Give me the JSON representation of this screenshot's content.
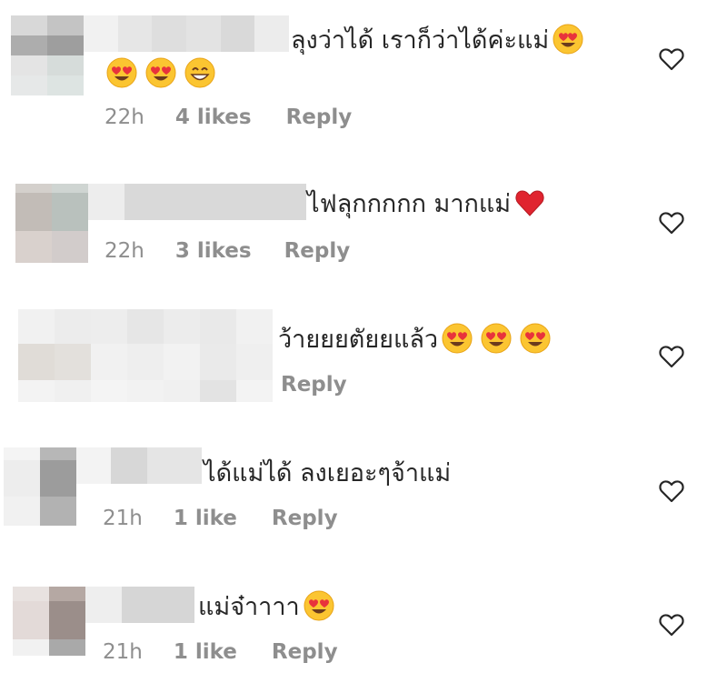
{
  "comments": [
    {
      "text": "ลุงว่าได้ เราก็ว่าได้ค่ะแม่",
      "emojis_inline": [
        "heart-eyes"
      ],
      "emojis_next_line": [
        "heart-eyes",
        "heart-eyes",
        "grinning"
      ],
      "time": "22h",
      "likes": "4 likes",
      "reply": "Reply"
    },
    {
      "text": "ไฟลุกกกกก มากแม่",
      "emojis_inline": [
        "red-heart"
      ],
      "emojis_next_line": [],
      "time": "22h",
      "likes": "3 likes",
      "reply": "Reply"
    },
    {
      "text": "ว้ายยยตัยยแล้ว",
      "emojis_inline": [
        "heart-eyes",
        "heart-eyes",
        "heart-eyes"
      ],
      "emojis_next_line": [],
      "time": "",
      "likes": "",
      "reply": "Reply"
    },
    {
      "text": "ได้แม่ได้ ลงเยอะๆจ้าแม่",
      "emojis_inline": [],
      "emojis_next_line": [],
      "time": "21h",
      "likes": "1 like",
      "reply": "Reply"
    },
    {
      "text": "แม่จ๋าาาา",
      "emojis_inline": [
        "heart-eyes"
      ],
      "emojis_next_line": [],
      "time": "21h",
      "likes": "1 like",
      "reply": "Reply"
    }
  ],
  "icons": {
    "like": "heart-outline-icon"
  },
  "colors": {
    "text": "#262626",
    "meta": "#8e8e8e",
    "heart_stroke": "#262626"
  }
}
